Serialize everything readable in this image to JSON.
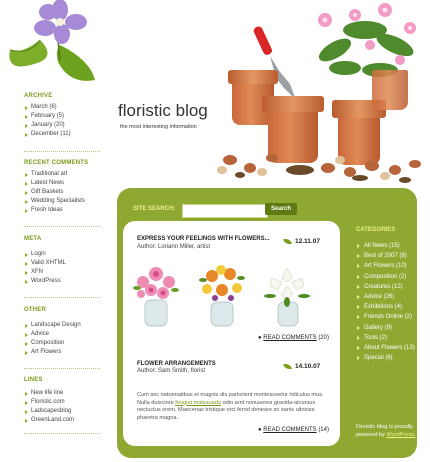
{
  "header": {
    "title": "floristic blog",
    "tagline": "the most interesting information"
  },
  "sidebar": {
    "archive": {
      "title": "ARCHIVE",
      "items": [
        "March (6)",
        "February (5)",
        "January (20)",
        "December (11)"
      ]
    },
    "recent_comments": {
      "title": "RECENT COMMENTS",
      "items": [
        "Traditional art",
        "Latest News",
        "Gift Baskets",
        "Wedding Specialists",
        "Fresh Ideas"
      ]
    },
    "meta": {
      "title": "META",
      "items": [
        "Login",
        "Valid XHTML",
        "XFN",
        "WordPress"
      ]
    },
    "other": {
      "title": "OTHER",
      "items": [
        "Landscape Design",
        "Advice",
        "Composition",
        "Art Flowers"
      ]
    },
    "lines": {
      "title": "LINES",
      "items": [
        "New life line",
        "Floristic.com",
        "Ladscapesblog",
        "GreenLand.com"
      ]
    }
  },
  "search": {
    "label": "SITE SEARCH:",
    "button": "Search",
    "value": ""
  },
  "posts": [
    {
      "title": "EXPRESS YOUR FEELINGS WITH FLOWERS...",
      "author": "Author: Loriann Miller, artist",
      "date": "12.11.07",
      "read_more": "READ COMMENTS",
      "comments": "(20)"
    },
    {
      "title": "FLOWER ARRANGEMENTS",
      "author": "Author: Sam Smith, florist",
      "date": "14.10.07",
      "excerpt_before": "Cum soc natoenatibus et magnis dis parturient montesceetur ridiculus mus. Nulla duiscinre ",
      "excerpt_link": "feugiat malesuada",
      "excerpt_after": " odio arnt nonuserea gravida-atcursus necluctus orem. Maecenas tristique orci ferod deneare so sanis ultricies pharetra magna.",
      "read_more": "READ COMMENTS",
      "comments": "(14)"
    }
  ],
  "categories": {
    "title": "CATEGORIES",
    "items": [
      "All News (15)",
      "Best of 2007 (8)",
      "Art Flowers (10)",
      "Composition (2)",
      "Creatures (12)",
      "Advice (26)",
      "Exhibitions (4)",
      "Friends Online (2)",
      "Gallery (9)",
      "Tools (2)",
      "About Flowers (13)",
      "Special (6)"
    ]
  },
  "footer": {
    "text": "Floristic blog is proudly powered by ",
    "link": "WordPress."
  },
  "colors": {
    "accent": "#8fa832",
    "accent_text": "#7a9a1a",
    "pot": "#d77a45"
  }
}
